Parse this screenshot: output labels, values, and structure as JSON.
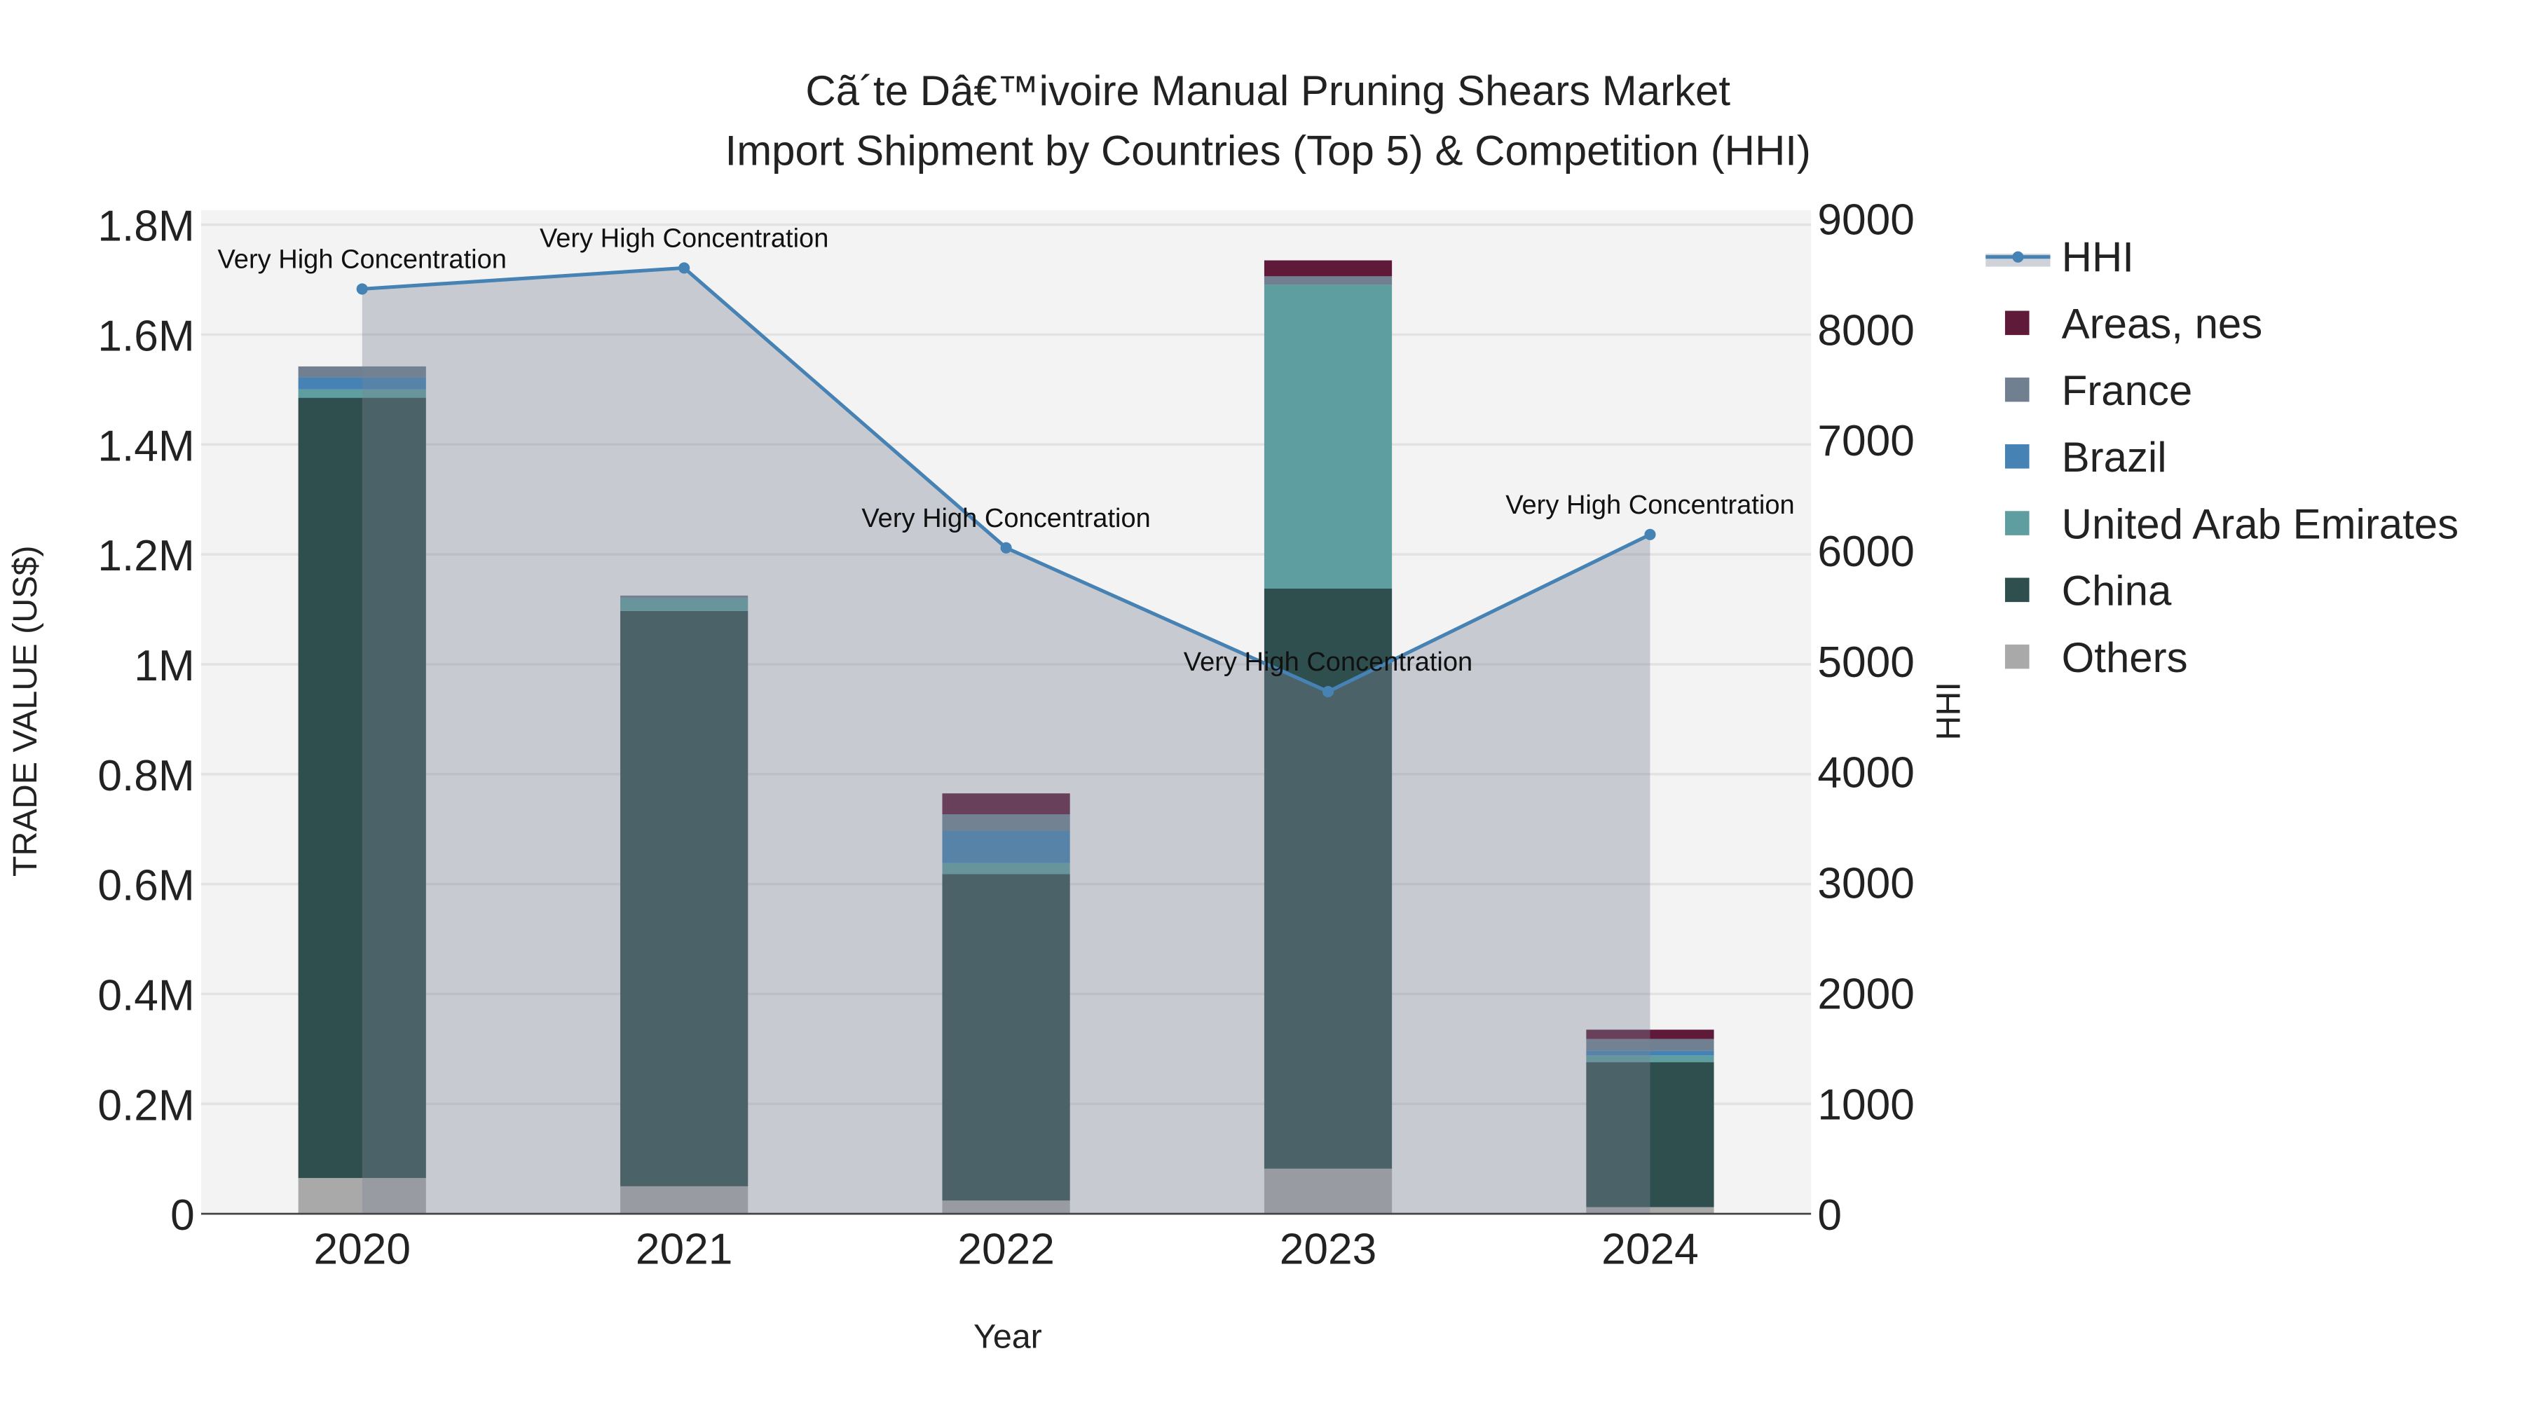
{
  "chart_data": {
    "type": "bar",
    "title": "Cã´te Dâ€™ivoire Manual Pruning Shears Market",
    "subtitle": "Import Shipment by Countries (Top 5) & Competition (HHI)",
    "xlabel": "Year",
    "ylabel": "TRADE VALUE (US$)",
    "y2label": "HHI",
    "categories": [
      "2020",
      "2021",
      "2022",
      "2023",
      "2024"
    ],
    "ylim": [
      0,
      1800000
    ],
    "y2lim": [
      0,
      9000
    ],
    "yticks": [
      {
        "v": 0,
        "label": "0"
      },
      {
        "v": 200000,
        "label": "0.2M"
      },
      {
        "v": 400000,
        "label": "0.4M"
      },
      {
        "v": 600000,
        "label": "0.6M"
      },
      {
        "v": 800000,
        "label": "0.8M"
      },
      {
        "v": 1000000,
        "label": "1M"
      },
      {
        "v": 1200000,
        "label": "1.2M"
      },
      {
        "v": 1400000,
        "label": "1.4M"
      },
      {
        "v": 1600000,
        "label": "1.6M"
      },
      {
        "v": 1800000,
        "label": "1.8M"
      }
    ],
    "y2ticks": [
      {
        "v": 0,
        "label": "0"
      },
      {
        "v": 1000,
        "label": "1000"
      },
      {
        "v": 2000,
        "label": "2000"
      },
      {
        "v": 3000,
        "label": "3000"
      },
      {
        "v": 4000,
        "label": "4000"
      },
      {
        "v": 5000,
        "label": "5000"
      },
      {
        "v": 6000,
        "label": "6000"
      },
      {
        "v": 7000,
        "label": "7000"
      },
      {
        "v": 8000,
        "label": "8000"
      },
      {
        "v": 9000,
        "label": "9000"
      }
    ],
    "grid": true,
    "legend_position": "right",
    "series": [
      {
        "name": "Others",
        "color": "#a9a9a9",
        "values": [
          65000,
          50000,
          24000,
          82000,
          12000
        ]
      },
      {
        "name": "China",
        "color": "#2f4f4f",
        "values": [
          1420000,
          1047000,
          594000,
          1056000,
          264000
        ]
      },
      {
        "name": "United Arab Emirates",
        "color": "#5f9ea0",
        "values": [
          15000,
          23000,
          20000,
          553000,
          12000
        ]
      },
      {
        "name": "Brazil",
        "color": "#4682b4",
        "values": [
          22000,
          0,
          59000,
          0,
          9000
        ]
      },
      {
        "name": "France",
        "color": "#708090",
        "values": [
          20000,
          5000,
          30000,
          15000,
          21000
        ]
      },
      {
        "name": "Areas, nes",
        "color": "#5f1a3a",
        "values": [
          0,
          0,
          38000,
          29000,
          17000
        ]
      }
    ],
    "hhi": {
      "name": "HHI",
      "color": "#4682b4",
      "values": [
        8360,
        8550,
        6020,
        4720,
        6140
      ],
      "annotations": [
        "Very High Concentration",
        "Very High Concentration",
        "Very High Concentration",
        "Very High Concentration",
        "Very High Concentration"
      ]
    },
    "legend_order": [
      "HHI",
      "Areas, nes",
      "France",
      "Brazil",
      "United Arab Emirates",
      "China",
      "Others"
    ]
  }
}
